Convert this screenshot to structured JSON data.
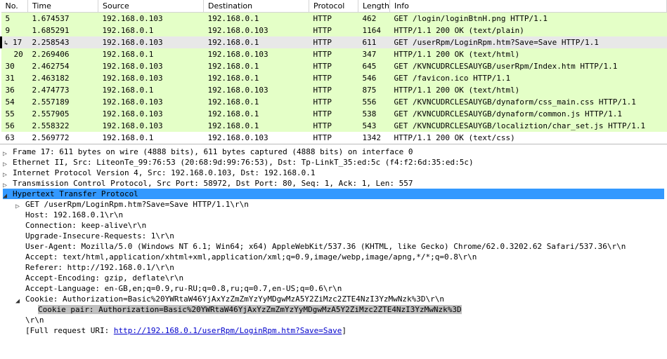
{
  "columns": {
    "no": "No.",
    "time": "Time",
    "src": "Source",
    "dst": "Destination",
    "proto": "Protocol",
    "len": "Length",
    "info": "Info"
  },
  "rows": [
    {
      "sel": false,
      "arrow": "",
      "no": "5",
      "time": "1.674537",
      "src": "192.168.0.103",
      "dst": "192.168.0.1",
      "proto": "HTTP",
      "len": "462",
      "info": "GET /login/loginBtnH.png HTTP/1.1"
    },
    {
      "sel": false,
      "arrow": "",
      "no": "9",
      "time": "1.685291",
      "src": "192.168.0.1",
      "dst": "192.168.0.103",
      "proto": "HTTP",
      "len": "1164",
      "info": "HTTP/1.1 200 OK  (text/plain)"
    },
    {
      "sel": true,
      "arrow": "↳",
      "no": "17",
      "time": "2.258543",
      "src": "192.168.0.103",
      "dst": "192.168.0.1",
      "proto": "HTTP",
      "len": "611",
      "info": "GET /userRpm/LoginRpm.htm?Save=Save HTTP/1.1"
    },
    {
      "sel": false,
      "arrow": "↲",
      "no": "20",
      "time": "2.269406",
      "src": "192.168.0.1",
      "dst": "192.168.0.103",
      "proto": "HTTP",
      "len": "347",
      "info": "HTTP/1.1 200 OK  (text/html)"
    },
    {
      "sel": false,
      "arrow": "",
      "no": "30",
      "time": "2.462754",
      "src": "192.168.0.103",
      "dst": "192.168.0.1",
      "proto": "HTTP",
      "len": "645",
      "info": "GET /KVNCUDRCLESAUYGB/userRpm/Index.htm HTTP/1.1"
    },
    {
      "sel": false,
      "arrow": "",
      "no": "31",
      "time": "2.463182",
      "src": "192.168.0.103",
      "dst": "192.168.0.1",
      "proto": "HTTP",
      "len": "546",
      "info": "GET /favicon.ico HTTP/1.1"
    },
    {
      "sel": false,
      "arrow": "",
      "no": "36",
      "time": "2.474773",
      "src": "192.168.0.1",
      "dst": "192.168.0.103",
      "proto": "HTTP",
      "len": "875",
      "info": "HTTP/1.1 200 OK  (text/html)"
    },
    {
      "sel": false,
      "arrow": "",
      "no": "54",
      "time": "2.557189",
      "src": "192.168.0.103",
      "dst": "192.168.0.1",
      "proto": "HTTP",
      "len": "556",
      "info": "GET /KVNCUDRCLESAUYGB/dynaform/css_main.css HTTP/1.1"
    },
    {
      "sel": false,
      "arrow": "",
      "no": "55",
      "time": "2.557905",
      "src": "192.168.0.103",
      "dst": "192.168.0.1",
      "proto": "HTTP",
      "len": "538",
      "info": "GET /KVNCUDRCLESAUYGB/dynaform/common.js HTTP/1.1"
    },
    {
      "sel": false,
      "arrow": "",
      "no": "56",
      "time": "2.558322",
      "src": "192.168.0.103",
      "dst": "192.168.0.1",
      "proto": "HTTP",
      "len": "543",
      "info": "GET /KVNCUDRCLESAUYGB/localiztion/char_set.js HTTP/1.1"
    },
    {
      "sel": false,
      "arrow": "",
      "no": "63",
      "time": "2.569772",
      "src": "192.168.0.1",
      "dst": "192.168.0.103",
      "proto": "HTTP",
      "len": "1342",
      "info": "HTTP/1.1 200 OK  (text/css)",
      "cut": true
    }
  ],
  "tree": {
    "frame": "Frame 17: 611 bytes on wire (4888 bits), 611 bytes captured (4888 bits) on interface 0",
    "eth": "Ethernet II, Src: LiteonTe_99:76:53 (20:68:9d:99:76:53), Dst: Tp-LinkT_35:ed:5c (f4:f2:6d:35:ed:5c)",
    "ip": "Internet Protocol Version 4, Src: 192.168.0.103, Dst: 192.168.0.1",
    "tcp": "Transmission Control Protocol, Src Port: 58972, Dst Port: 80, Seq: 1, Ack: 1, Len: 557",
    "http": "Hypertext Transfer Protocol",
    "get": "GET /userRpm/LoginRpm.htm?Save=Save HTTP/1.1\\r\\n",
    "hdrs": [
      "Host: 192.168.0.1\\r\\n",
      "Connection: keep-alive\\r\\n",
      "Upgrade-Insecure-Requests: 1\\r\\n",
      "User-Agent: Mozilla/5.0 (Windows NT 6.1; Win64; x64) AppleWebKit/537.36 (KHTML, like Gecko) Chrome/62.0.3202.62 Safari/537.36\\r\\n",
      "Accept: text/html,application/xhtml+xml,application/xml;q=0.9,image/webp,image/apng,*/*;q=0.8\\r\\n",
      "Referer: http://192.168.0.1/\\r\\n",
      "Accept-Encoding: gzip, deflate\\r\\n",
      "Accept-Language: en-GB,en;q=0.9,ru-RU;q=0.8,ru;q=0.7,en-US;q=0.6\\r\\n"
    ],
    "cookie": "Cookie: Authorization=Basic%20YWRtaW46YjAxYzZmZmYzYyMDgwMzA5Y2ZiMzc2ZTE4NzI3YzMwNzk%3D\\r\\n",
    "cookie_pair": "Cookie pair: Authorization=Basic%20YWRtaW46YjAxYzZmZmYzYyMDgwMzA5Y2ZiMzc2ZTE4NzI3YzMwNzk%3D",
    "crlf": "\\r\\n",
    "full_uri_lbl": "[Full request URI: ",
    "full_uri": "http://192.168.0.1/userRpm/LoginRpm.htm?Save=Save",
    "full_uri_end": "]"
  }
}
